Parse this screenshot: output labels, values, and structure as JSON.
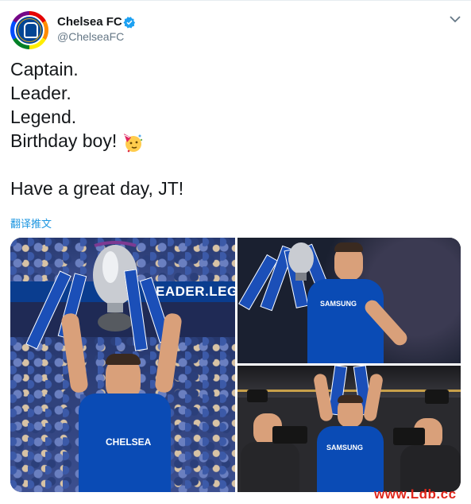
{
  "account": {
    "name": "Chelsea FC",
    "handle": "@ChelseaFC",
    "avatar_icon": "chelsea-crest-rainbow-avatar",
    "verified_icon": "verified-badge-icon"
  },
  "tweet": {
    "lines": [
      "Captain.",
      "Leader.",
      "Legend.",
      "Birthday boy!",
      "Have a great day, JT!"
    ],
    "emoji": "partying-face-emoji",
    "translate_label": "翻译推文"
  },
  "media": {
    "photo1_banner": "EADER.LEGE",
    "photo2_sponsor": "SAMSUNG",
    "photo3_sponsor": "SAMSUNG"
  },
  "colors": {
    "link": "#1b95e0",
    "chelsea_blue": "#034694",
    "verified": "#1da1f2",
    "watermark": "#e0281c"
  },
  "watermark": "www.Ldb.cc"
}
